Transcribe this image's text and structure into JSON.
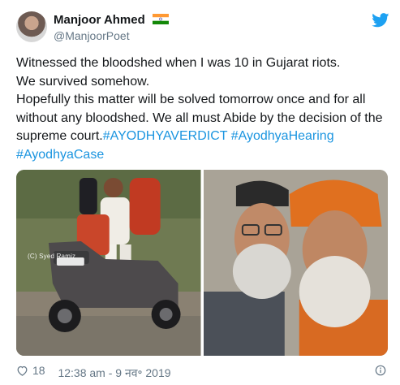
{
  "author": {
    "name": "Manjoor Ahmed",
    "handle": "@ManjoorPoet",
    "flag_icon": "india-flag-icon",
    "avatar_icon": "user-avatar"
  },
  "brand": {
    "icon": "twitter-bird-icon",
    "color": "#1da1f2"
  },
  "tweet": {
    "line1": "Witnessed the bloodshed when I was 10 in Gujarat riots.",
    "line2": "We survived somehow.",
    "line3_text": "Hopefully this matter will be solved tomorrow once and for all without any bloodshed. We all must Abide by the decision of the supreme court.",
    "hashtags": [
      "#AYODHYAVERDICT",
      "#AyodhyaHearing",
      "#AyodhyaCase"
    ],
    "link_color": "#1b95e0"
  },
  "media": {
    "photo1_watermark": "(C) Syed Ramiz"
  },
  "footer": {
    "like_count": "18",
    "timestamp": "12:38 am - 9 नव॰ 2019",
    "like_icon": "heart-icon",
    "info_icon": "info-icon"
  }
}
